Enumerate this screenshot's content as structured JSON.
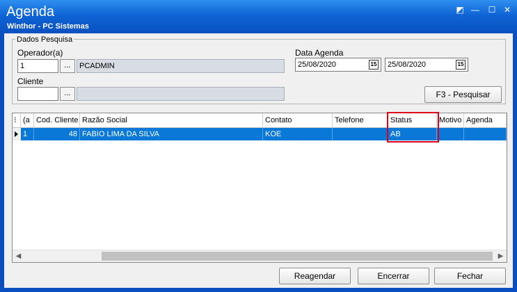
{
  "window": {
    "title": "Agenda",
    "subtitle": "Winthor - PC Sistemas",
    "controls": {
      "help": "◩",
      "minimize": "—",
      "maximize": "☐",
      "close": "✕"
    }
  },
  "search": {
    "group_label": "Dados Pesquisa",
    "operator": {
      "label": "Operador(a)",
      "code": "1",
      "name": "PCADMIN",
      "lookup": "..."
    },
    "client": {
      "label": "Cliente",
      "code": "",
      "name": "",
      "lookup": "..."
    },
    "date": {
      "label": "Data Agenda",
      "from": "25/08/2020",
      "to": "25/08/2020",
      "cal_icon": "15"
    },
    "search_button": "F3 - Pesquisar"
  },
  "grid": {
    "columns": [
      "(a",
      "Cod. Cliente",
      "Razão Social",
      "Contato",
      "Telefone",
      "Status",
      "Motivo",
      "Agenda"
    ],
    "rows": [
      {
        "a": "1",
        "cod_cliente": "48",
        "razao_social": "FABIO LIMA DA SILVA",
        "contato": "KOE",
        "telefone": "",
        "status": "AB",
        "motivo": "",
        "agenda": ""
      }
    ]
  },
  "footer": {
    "reagendar": "Reagendar",
    "encerrar": "Encerrar",
    "fechar": "Fechar"
  }
}
